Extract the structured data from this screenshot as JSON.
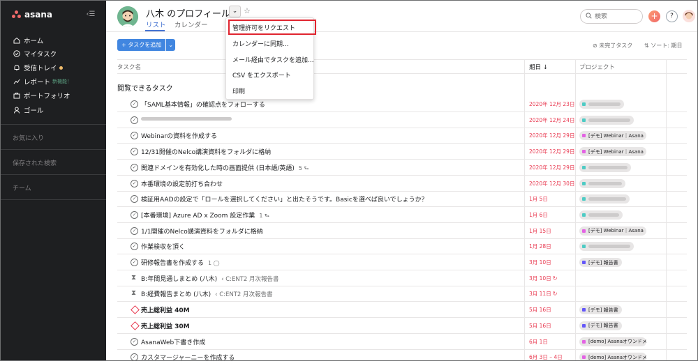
{
  "sidebar": {
    "brand": "asana",
    "nav": [
      {
        "label": "ホーム",
        "icon": "home-icon"
      },
      {
        "label": "マイタスク",
        "icon": "check-circle-icon"
      },
      {
        "label": "受信トレイ",
        "icon": "bell-icon"
      },
      {
        "label": "レポート",
        "icon": "chart-line-icon",
        "badge": "新機能！"
      },
      {
        "label": "ポートフォリオ",
        "icon": "portfolio-icon"
      },
      {
        "label": "ゴール",
        "icon": "person-icon"
      }
    ],
    "sections": [
      "お気に入り",
      "保存された検索",
      "チーム"
    ]
  },
  "header": {
    "title": "八木 のプロフィール",
    "tabs": [
      "リスト",
      "カレンダー"
    ],
    "search_placeholder": "検索"
  },
  "toolbar": {
    "add_task": "タスクを追加",
    "incomplete": "未完了タスク",
    "sort": "ソート: 期日"
  },
  "menu": {
    "items": [
      "管理許可をリクエスト",
      "カレンダーに同期...",
      "メール経由でタスクを追加...",
      "CSV をエクスポート",
      "印刷"
    ]
  },
  "table": {
    "headers": {
      "name": "タスク名",
      "due": "期日 ↓",
      "project": "プロジェクト"
    },
    "section": "閲覧できるタスク",
    "rows": [
      {
        "name": "「SAML基本情報」の確認点をフォローする",
        "due": "2020年 12月 23日",
        "project": "",
        "color": "#4ecbc4"
      },
      {
        "name": "",
        "due": "2020年 12月 24日",
        "project": "",
        "color": "#4ecbc4"
      },
      {
        "name": "Webinarの資料を作成する",
        "due": "2020年 12月 29日",
        "project": "[デモ] Webinar｜Asana",
        "color": "#e362e3"
      },
      {
        "name": "12/31開催のNelco講演資料をフォルダに格納",
        "due": "2020年 12月 29日",
        "project": "[デモ] Webinar｜Asana",
        "color": "#e362e3"
      },
      {
        "name": "関連ドメインを有効化した時の画面提供 (日本語/英語)",
        "sub": "5 ⮑",
        "due": "2020年 12月 29日",
        "project": "",
        "color": "#4ecbc4"
      },
      {
        "name": "本番環境の設定前打ち合わせ",
        "due": "2020年 12月 30日",
        "project": "",
        "color": "#4ecbc4"
      },
      {
        "name": "検証用AADの設定で「ロールを選択してください」と出たそうです。Basicを選べば良いでしょうか？",
        "due": "1月 5日",
        "project": "",
        "color": "#4ecbc4"
      },
      {
        "name": "[本番環境] Azure AD x Zoom 設定作業",
        "sub": "1 ⮑",
        "due": "1月 6日",
        "project": "",
        "color": "#4ecbc4"
      },
      {
        "name": "1/1開催のNelco講演資料をフォルダに格納",
        "due": "1月 15日",
        "project": "[デモ] Webinar｜Asana",
        "color": "#e362e3"
      },
      {
        "name": "作業検収を頂く",
        "due": "1月 28日",
        "project": "",
        "color": "#4ecbc4"
      },
      {
        "name": "研修報告書を作成する",
        "sub": "1 ◯",
        "due": "3月 10日",
        "project": "[デモ] 報告書",
        "color": "#6457f9"
      },
      {
        "name": "B:年間見通しまとめ (八木)",
        "parent": "‹ C:ENT2 月次報告書",
        "due": "3月 10日",
        "recur": "↻",
        "project": "",
        "color": "",
        "kind": "hourglass"
      },
      {
        "name": "B:経費報告まとめ (八木)",
        "parent": "‹ C:ENT2 月次報告書",
        "due": "3月 11日",
        "recur": "↻",
        "project": "",
        "color": "",
        "kind": "hourglass"
      },
      {
        "name": "売上総利益 40M",
        "due": "5月 16日",
        "project": "[デモ] 報告書",
        "color": "#6457f9",
        "kind": "milestone"
      },
      {
        "name": "売上総利益 30M",
        "due": "5月 16日",
        "project": "[デモ] 報告書",
        "color": "#6457f9",
        "kind": "milestone"
      },
      {
        "name": "AsanaWeb下書き作成",
        "due": "6月 1日",
        "project": "[demo] Asanaオウンドメ...",
        "color": "#e362e3"
      },
      {
        "name": "カスタマージャーニーを作成する",
        "due": "6月 3日 – 4日",
        "project": "[demo] Asanaオウンドメ...",
        "color": "#e362e3"
      }
    ]
  },
  "colors": {
    "sidebar": "#1e1f21",
    "accent": "#4186e0",
    "overdue": "#e8384f",
    "highlight": "#e0242f"
  }
}
